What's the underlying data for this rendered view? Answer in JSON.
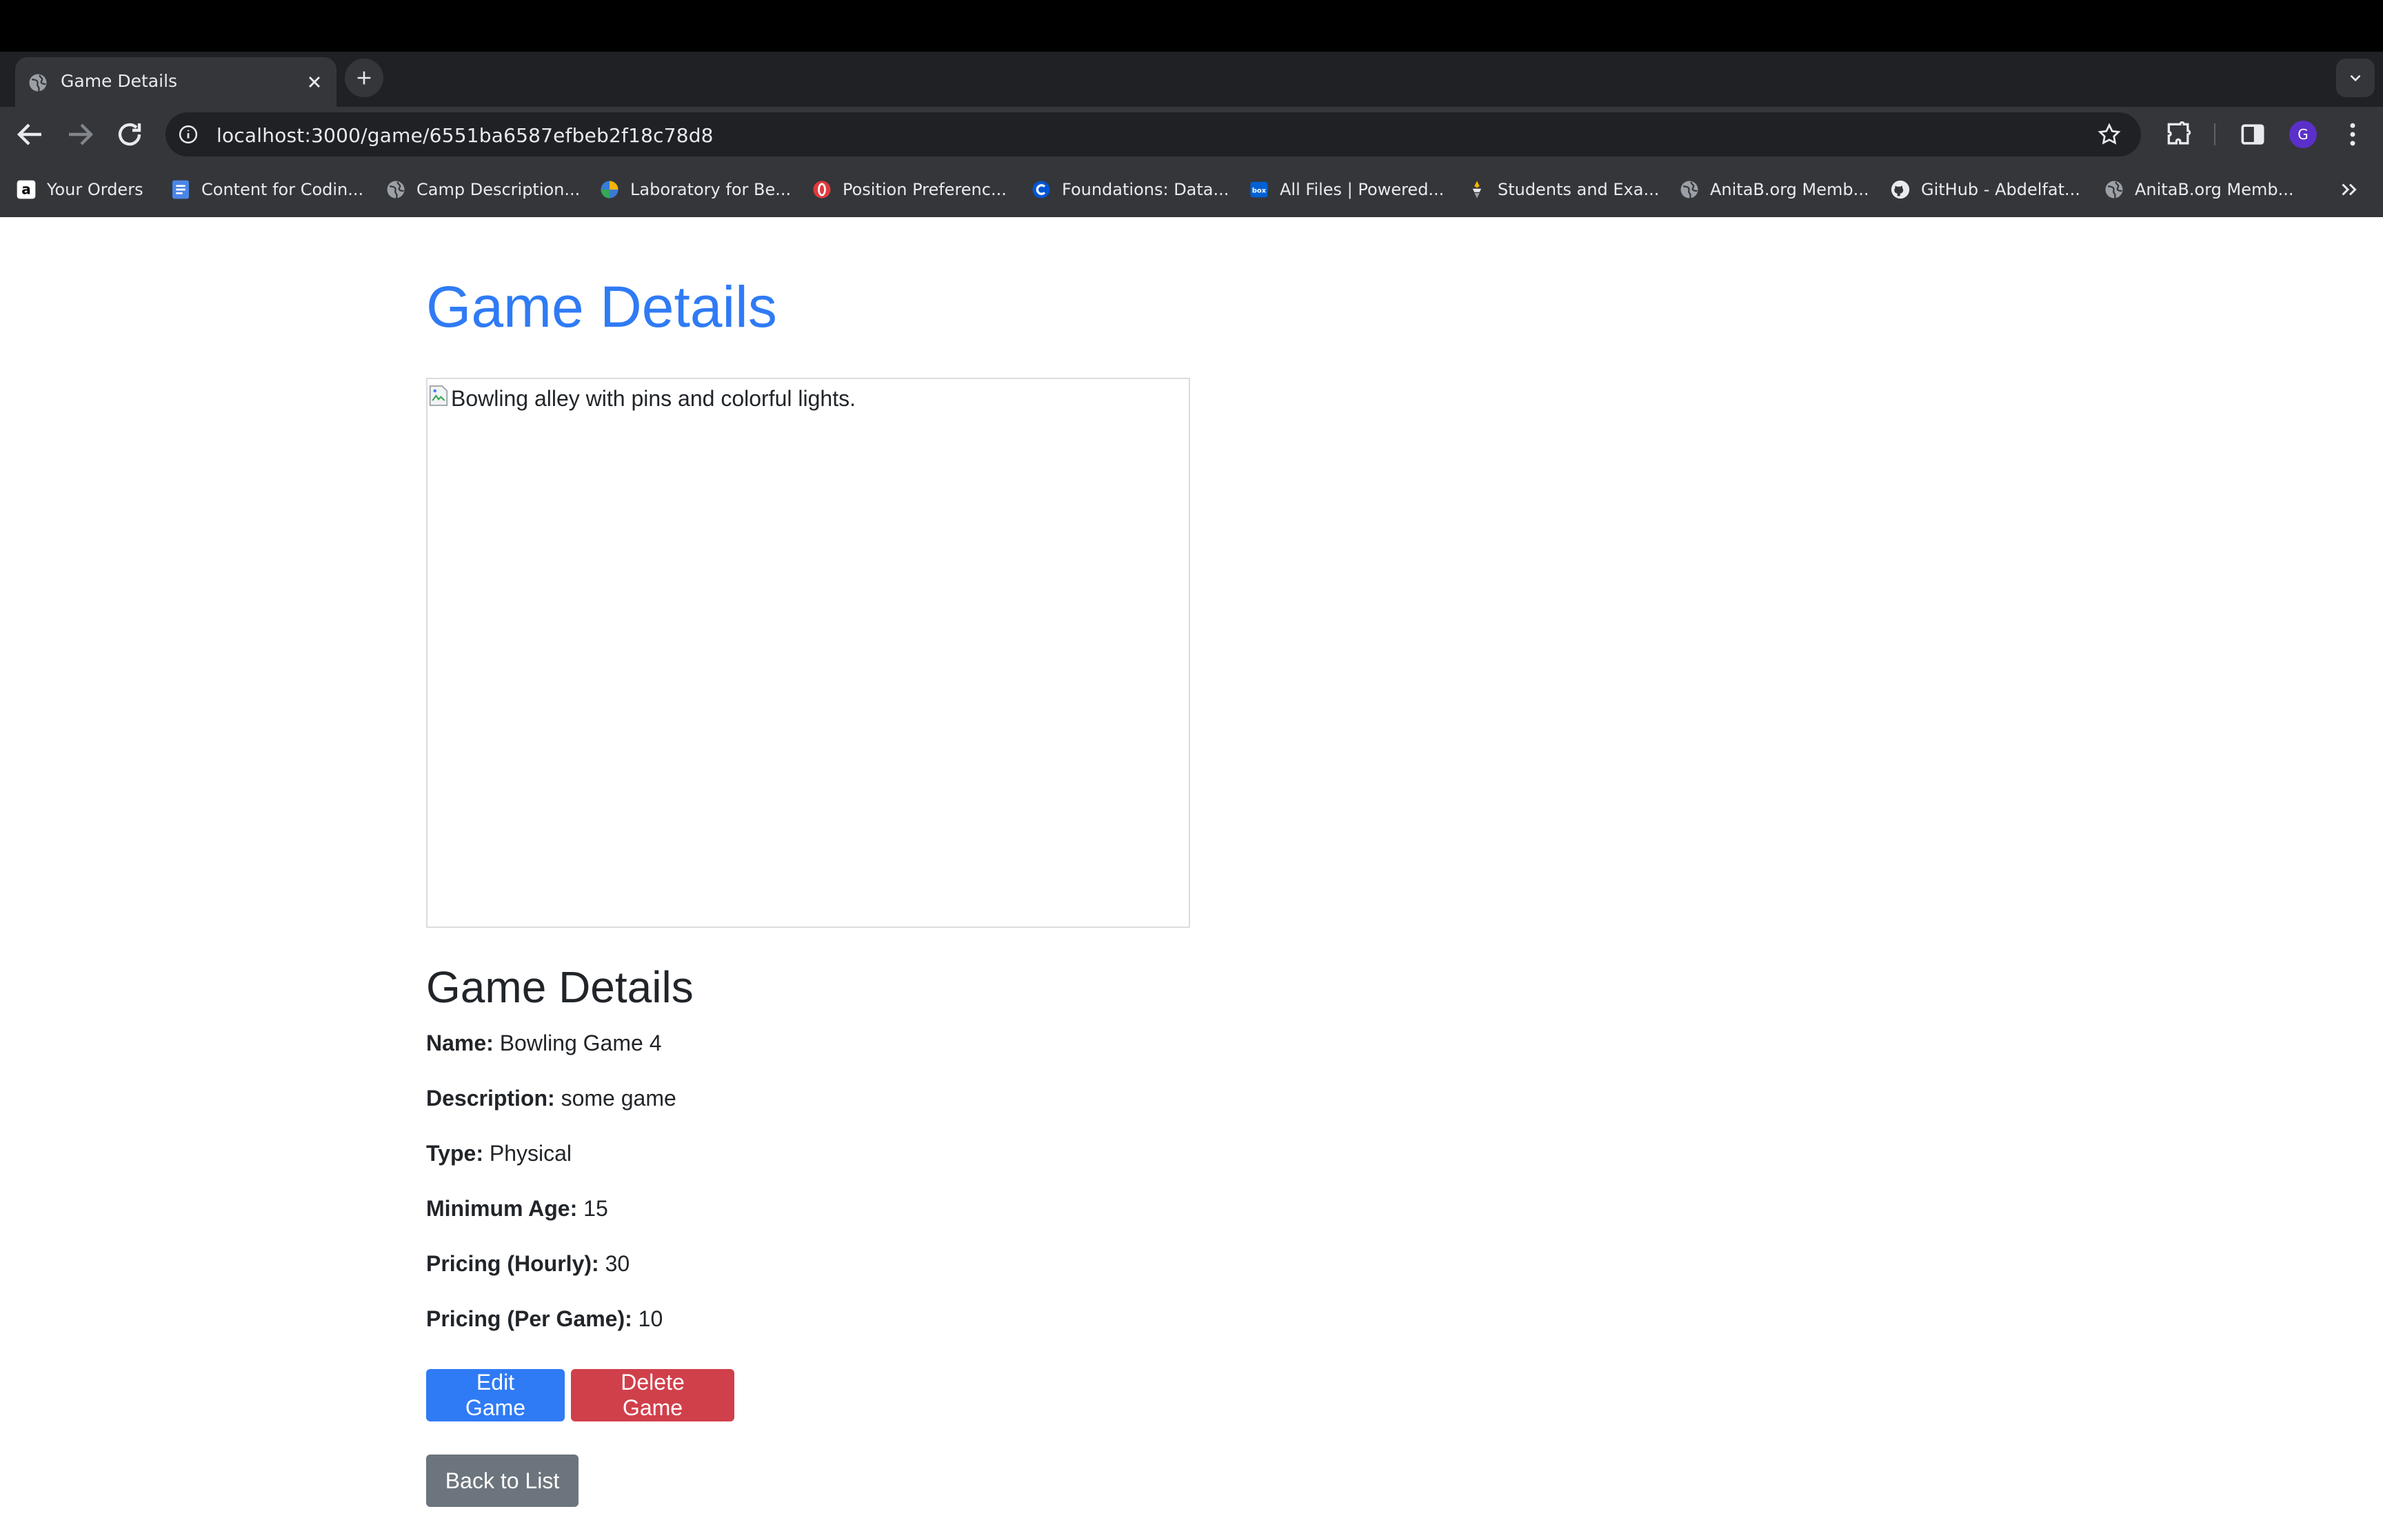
{
  "browser": {
    "tab": {
      "title": "Game Details",
      "favicon": "globe-icon"
    },
    "url": "localhost:3000/game/6551ba6587efbeb2f18c78d8",
    "avatar_letter": "G",
    "bookmarks": [
      {
        "label": "Your Orders",
        "icon": "amazon-icon"
      },
      {
        "label": "Content for Codin...",
        "icon": "docs-icon"
      },
      {
        "label": "Camp Description...",
        "icon": "globe-icon"
      },
      {
        "label": "Laboratory for Be...",
        "icon": "lab-icon"
      },
      {
        "label": "Position Preferenc...",
        "icon": "opera-icon"
      },
      {
        "label": "Foundations: Data...",
        "icon": "coursera-icon"
      },
      {
        "label": "All Files | Powered...",
        "icon": "box-icon"
      },
      {
        "label": "Students and Exa...",
        "icon": "students-icon"
      },
      {
        "label": "AnitaB.org Memb...",
        "icon": "globe-icon"
      },
      {
        "label": "GitHub - Abdelfat...",
        "icon": "github-icon"
      },
      {
        "label": "AnitaB.org Memb...",
        "icon": "globe-icon"
      }
    ]
  },
  "page": {
    "title": "Game Details",
    "image_alt": "Bowling alley with pins and colorful lights.",
    "section_heading": "Game Details",
    "details": [
      {
        "label": "Name:",
        "value": "Bowling Game 4"
      },
      {
        "label": "Description:",
        "value": "some game"
      },
      {
        "label": "Type:",
        "value": "Physical"
      },
      {
        "label": "Minimum Age:",
        "value": "15"
      },
      {
        "label": "Pricing (Hourly):",
        "value": "30"
      },
      {
        "label": "Pricing (Per Game):",
        "value": "10"
      }
    ],
    "buttons": {
      "edit": "Edit Game",
      "delete": "Delete Game",
      "back": "Back to List"
    }
  },
  "colors": {
    "title_blue": "#2f7bf5",
    "edit_button": "#2f7bf5",
    "delete_button": "#d0404b",
    "back_button": "#6c757d"
  }
}
